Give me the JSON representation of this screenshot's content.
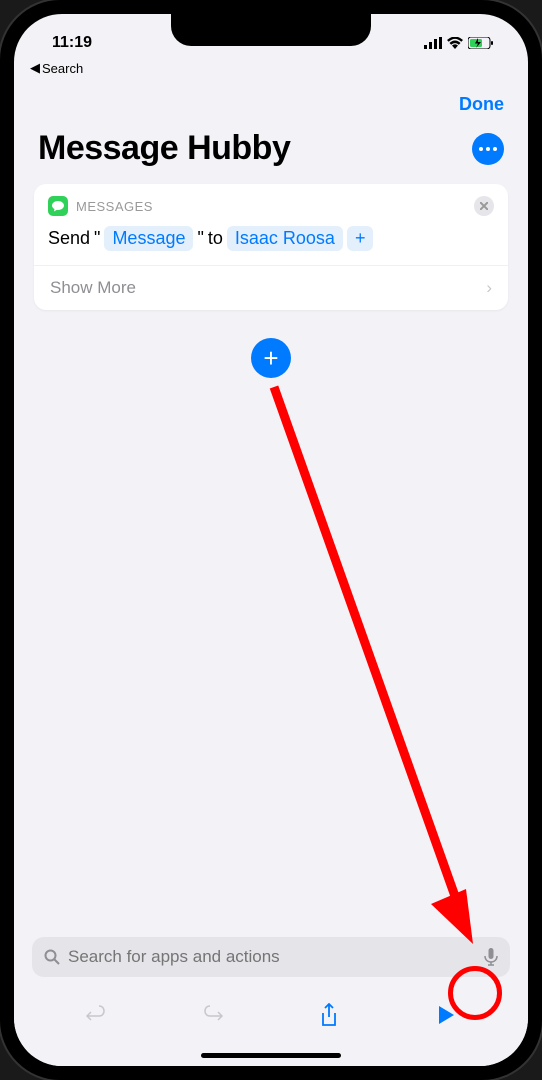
{
  "statusBar": {
    "time": "11:19",
    "backLabel": "Search"
  },
  "nav": {
    "doneLabel": "Done"
  },
  "header": {
    "title": "Message Hubby"
  },
  "actionCard": {
    "appName": "MESSAGES",
    "sendPrefix": "Send",
    "quoteOpen": "\"",
    "messageToken": "Message",
    "quoteClose": "\"",
    "toLabel": "to",
    "recipientToken": "Isaac Roosa",
    "plusLabel": "+",
    "showMoreLabel": "Show More"
  },
  "search": {
    "placeholder": "Search for apps and actions"
  }
}
